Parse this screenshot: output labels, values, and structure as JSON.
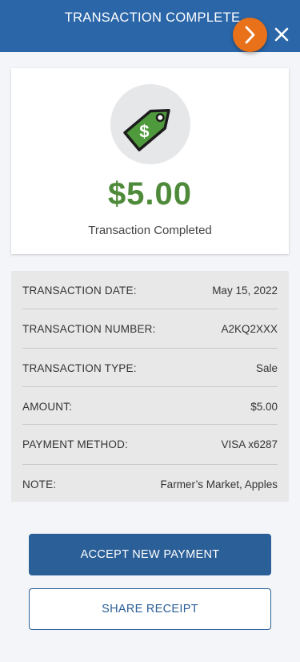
{
  "header": {
    "title": "TRANSACTION COMPLETE",
    "close_icon": "close-icon",
    "next_icon": "chevron-right-icon"
  },
  "summary": {
    "icon": "price-tag-icon",
    "amount": "$5.00",
    "status": "Transaction Completed"
  },
  "details": [
    {
      "label": "TRANSACTION DATE:",
      "value": "May 15, 2022"
    },
    {
      "label": "TRANSACTION NUMBER:",
      "value": "A2KQ2XXX"
    },
    {
      "label": "TRANSACTION TYPE:",
      "value": "Sale"
    },
    {
      "label": "AMOUNT:",
      "value": "$5.00"
    },
    {
      "label": "PAYMENT METHOD:",
      "value": "VISA x6287"
    },
    {
      "label": "NOTE:",
      "value": "Farmer’s Market, Apples"
    }
  ],
  "actions": {
    "accept_new_payment": "ACCEPT NEW PAYMENT",
    "share_receipt": "SHARE RECEIPT"
  },
  "colors": {
    "header": "#2b66a8",
    "accent_orange": "#e8711a",
    "amount_green": "#4e8a3a",
    "primary_button": "#2b5f98"
  }
}
